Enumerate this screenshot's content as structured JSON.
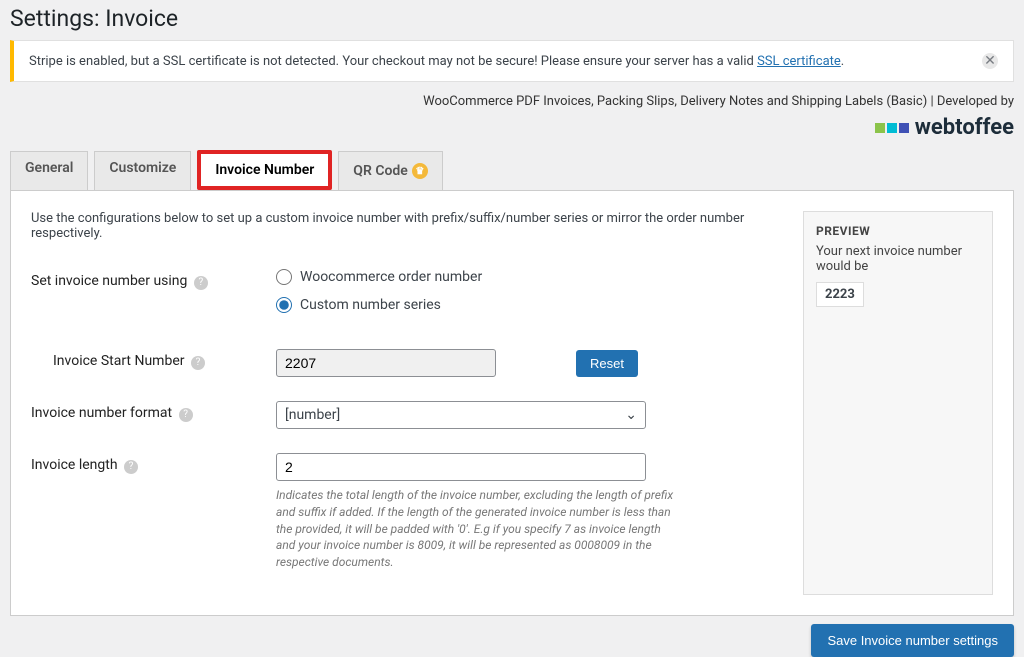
{
  "page_title": "Settings: Invoice",
  "notice": {
    "text_before": "Stripe is enabled, but a SSL certificate is not detected. Your checkout may not be secure! Please ensure your server has a valid ",
    "link_text": "SSL certificate",
    "text_after": "."
  },
  "meta_text": "WooCommerce PDF Invoices, Packing Slips, Delivery Notes and Shipping Labels (Basic) | Developed by",
  "brand": "webtoffee",
  "tabs": {
    "general": "General",
    "customize": "Customize",
    "invoice_number": "Invoice Number",
    "qrcode": "QR Code"
  },
  "intro": "Use the configurations below to set up a custom invoice number with prefix/suffix/number series or mirror the order number respectively.",
  "labels": {
    "set_using": "Set invoice number using",
    "start_number": "Invoice Start Number",
    "format": "Invoice number format",
    "length": "Invoice length"
  },
  "radio": {
    "woo": "Woocommerce order number",
    "custom": "Custom number series"
  },
  "values": {
    "start_number": "2207",
    "format": "[number]",
    "length": "2"
  },
  "buttons": {
    "reset": "Reset",
    "save": "Save Invoice number settings"
  },
  "help_text": "Indicates the total length of the invoice number, excluding the length of prefix and suffix if added. If the length of the generated invoice number is less than the provided, it will be padded with '0'. E.g if you specify 7 as invoice length and your invoice number is 8009, it will be represented as 0008009 in the respective documents.",
  "preview": {
    "title": "PREVIEW",
    "desc": "Your next invoice number would be",
    "number": "2223"
  }
}
